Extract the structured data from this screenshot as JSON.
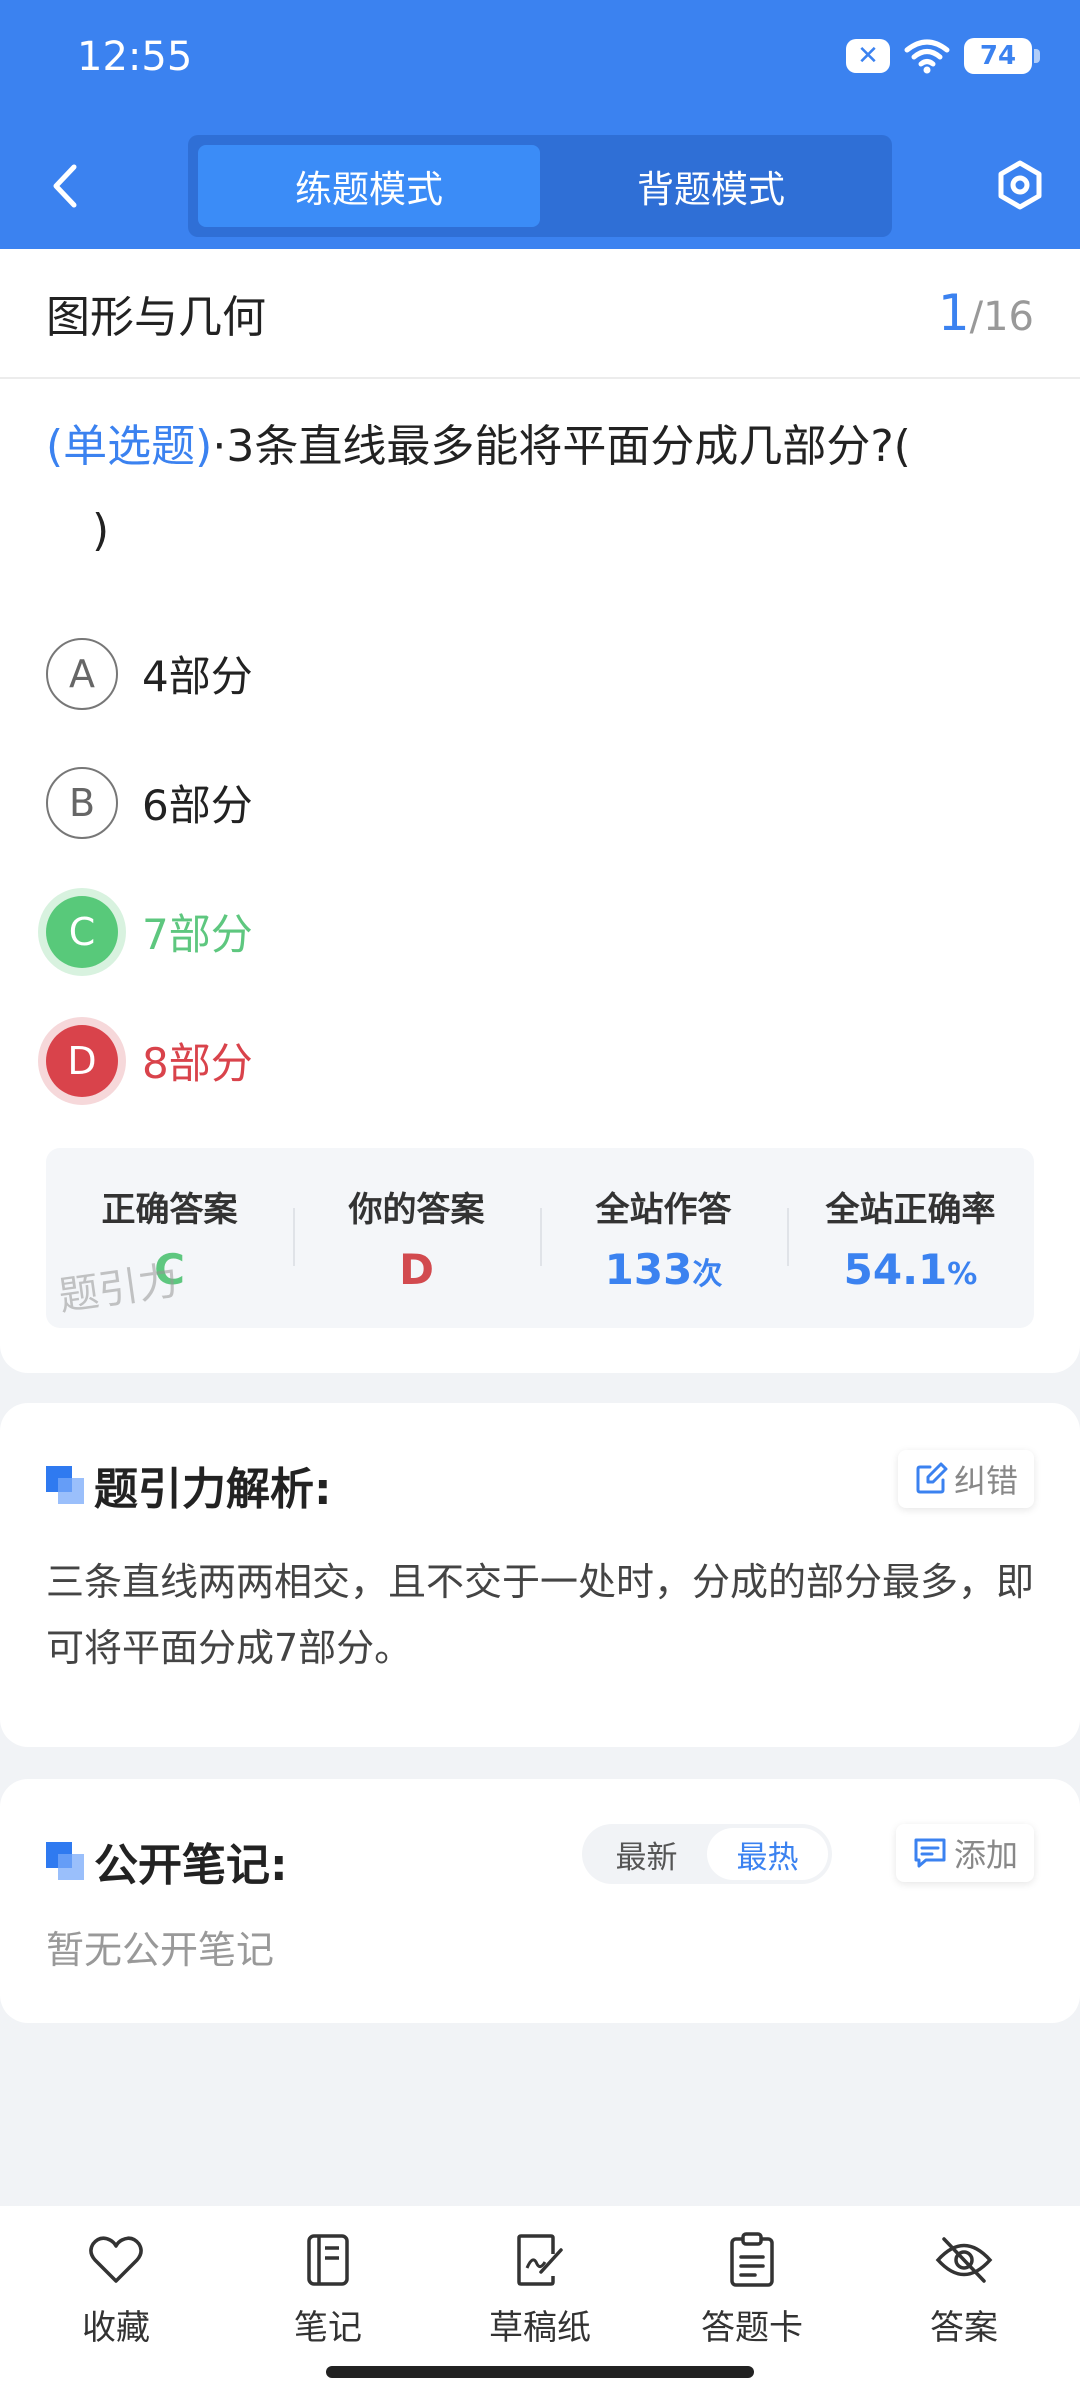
{
  "status": {
    "time": "12:55",
    "battery": "74"
  },
  "header": {
    "tabs": [
      {
        "label": "练题模式"
      },
      {
        "label": "背题模式"
      }
    ]
  },
  "section": {
    "title": "图形与几何",
    "current": "1",
    "total": "/16"
  },
  "question": {
    "type": "(单选题)",
    "text": "·3条直线最多能将平面分成几部分?(",
    "tail": ")"
  },
  "options": [
    {
      "letter": "A",
      "text": "4部分"
    },
    {
      "letter": "B",
      "text": "6部分"
    },
    {
      "letter": "C",
      "text": "7部分"
    },
    {
      "letter": "D",
      "text": "8部分"
    }
  ],
  "stats": {
    "correct_label": "正确答案",
    "correct_value": "C",
    "yours_label": "你的答案",
    "yours_value": "D",
    "attempts_label": "全站作答",
    "attempts_value": "133",
    "attempts_unit": "次",
    "rate_label": "全站正确率",
    "rate_value": "54.1",
    "rate_unit": "%"
  },
  "watermark": "题引力",
  "analysis": {
    "title": "题引力解析:",
    "correct_btn": "纠错",
    "text": "三条直线两两相交，且不交于一处时，分成的部分最多，即可将平面分成7部分。"
  },
  "notes": {
    "title": "公开笔记:",
    "sort": [
      "最新",
      "最热"
    ],
    "add_btn": "添加",
    "empty": "暂无公开笔记"
  },
  "bottom_nav": [
    {
      "label": "收藏",
      "icon": "heart-icon"
    },
    {
      "label": "笔记",
      "icon": "notebook-icon"
    },
    {
      "label": "草稿纸",
      "icon": "draft-icon"
    },
    {
      "label": "答题卡",
      "icon": "clipboard-icon"
    },
    {
      "label": "答案",
      "icon": "eye-off-icon"
    }
  ],
  "colors": {
    "primary": "#3b82f0",
    "correct": "#58c97a",
    "wrong": "#d9434b"
  }
}
